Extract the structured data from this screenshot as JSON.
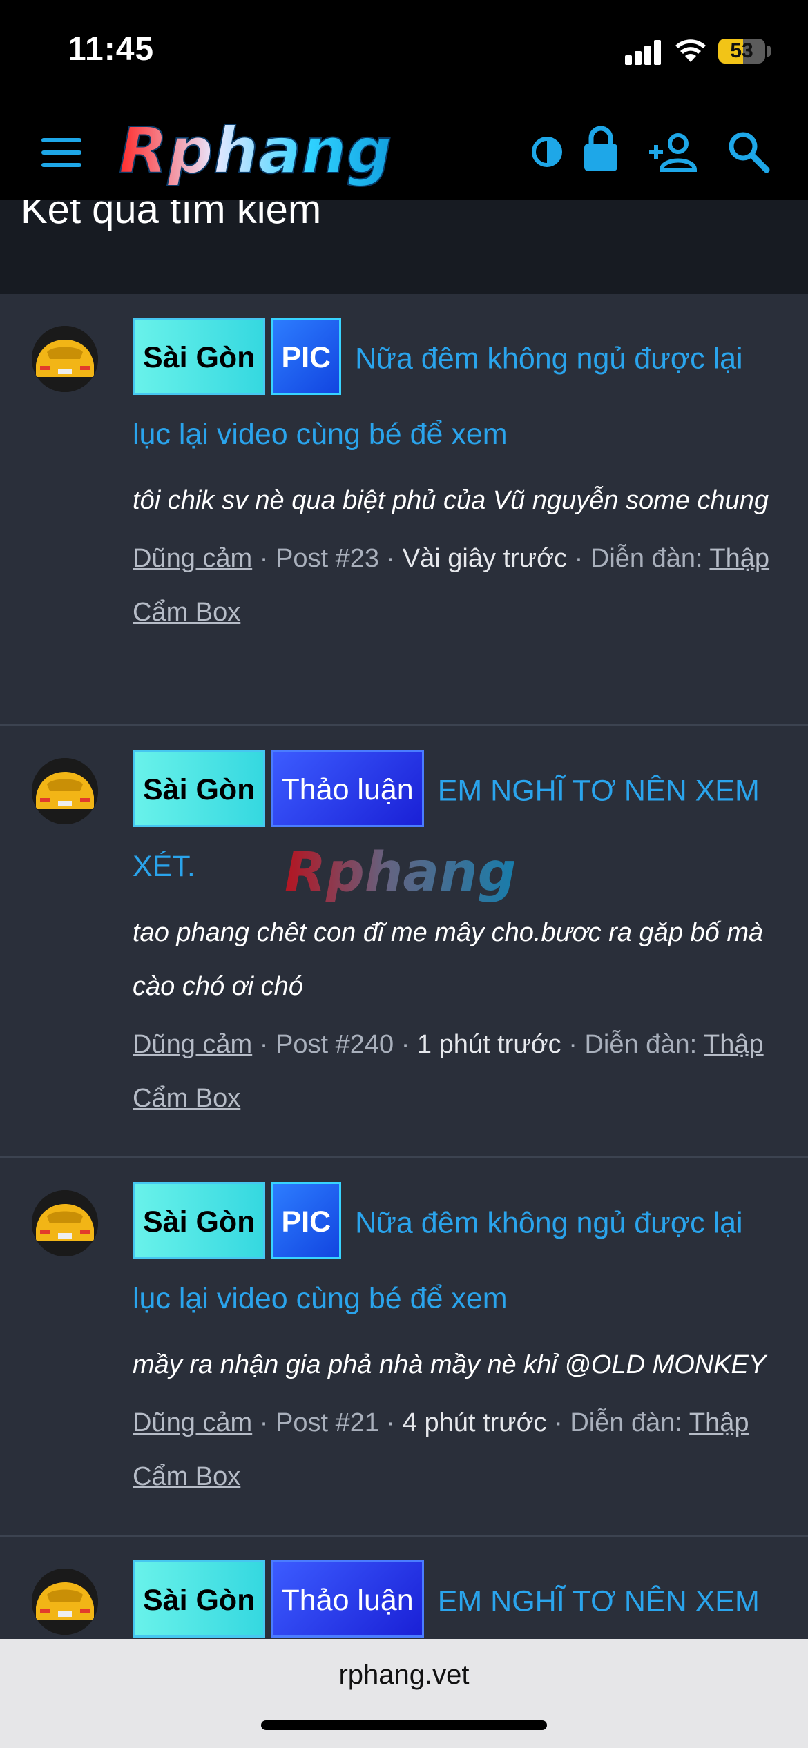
{
  "status_bar": {
    "time": "11:45",
    "battery": "53",
    "battery_level": 0.53
  },
  "header": {
    "logo_text": "Rphang",
    "icons": [
      "menu-icon",
      "contrast-icon",
      "lock-icon",
      "add-user-icon",
      "search-icon"
    ]
  },
  "page": {
    "title": "Kết quả tìm kiếm"
  },
  "results": [
    {
      "badge1": "Sài Gòn",
      "badge2": "PIC",
      "title": "Nữa đêm không ngủ được lại lục lại video cùng bé để xem",
      "snippet": "tôi chik sv nè qua biệt phủ của Vũ nguyễn some chung",
      "author": "Dũng cảm",
      "post": "Post #23",
      "time": "Vài giây trước",
      "forum_label": "Diễn đàn:",
      "forum": "Thập Cẩm Box"
    },
    {
      "badge1": "Sài Gòn",
      "badge2": "Thảo luận",
      "title": "EM NGHĨ TƠ NÊN XEM XÉT.",
      "snippet": "tao phang chêt con đĩ me mây cho.bươc ra găp bố mà cào chó ơi chó",
      "author": "Dũng cảm",
      "post": "Post #240",
      "time": "1 phút trước",
      "forum_label": "Diễn đàn:",
      "forum": "Thập Cẩm Box"
    },
    {
      "badge1": "Sài Gòn",
      "badge2": "PIC",
      "title": "Nữa đêm không ngủ được lại lục lại video cùng bé để xem",
      "snippet": "mầy ra nhận gia phả nhà mầy nè khỉ @OLD MONKEY",
      "author": "Dũng cảm",
      "post": "Post #21",
      "time": "4 phút trước",
      "forum_label": "Diễn đàn:",
      "forum": "Thập Cẩm Box"
    },
    {
      "badge1": "Sài Gòn",
      "badge2": "Thảo luận",
      "title": "EM NGHĨ TƠ NÊN XEM"
    }
  ],
  "watermark_text": "Rphang",
  "browser": {
    "url": "rphang.vet"
  },
  "colors": {
    "accent": "#2aa4ec",
    "background": "#2a2f3a",
    "header": "#000000"
  }
}
